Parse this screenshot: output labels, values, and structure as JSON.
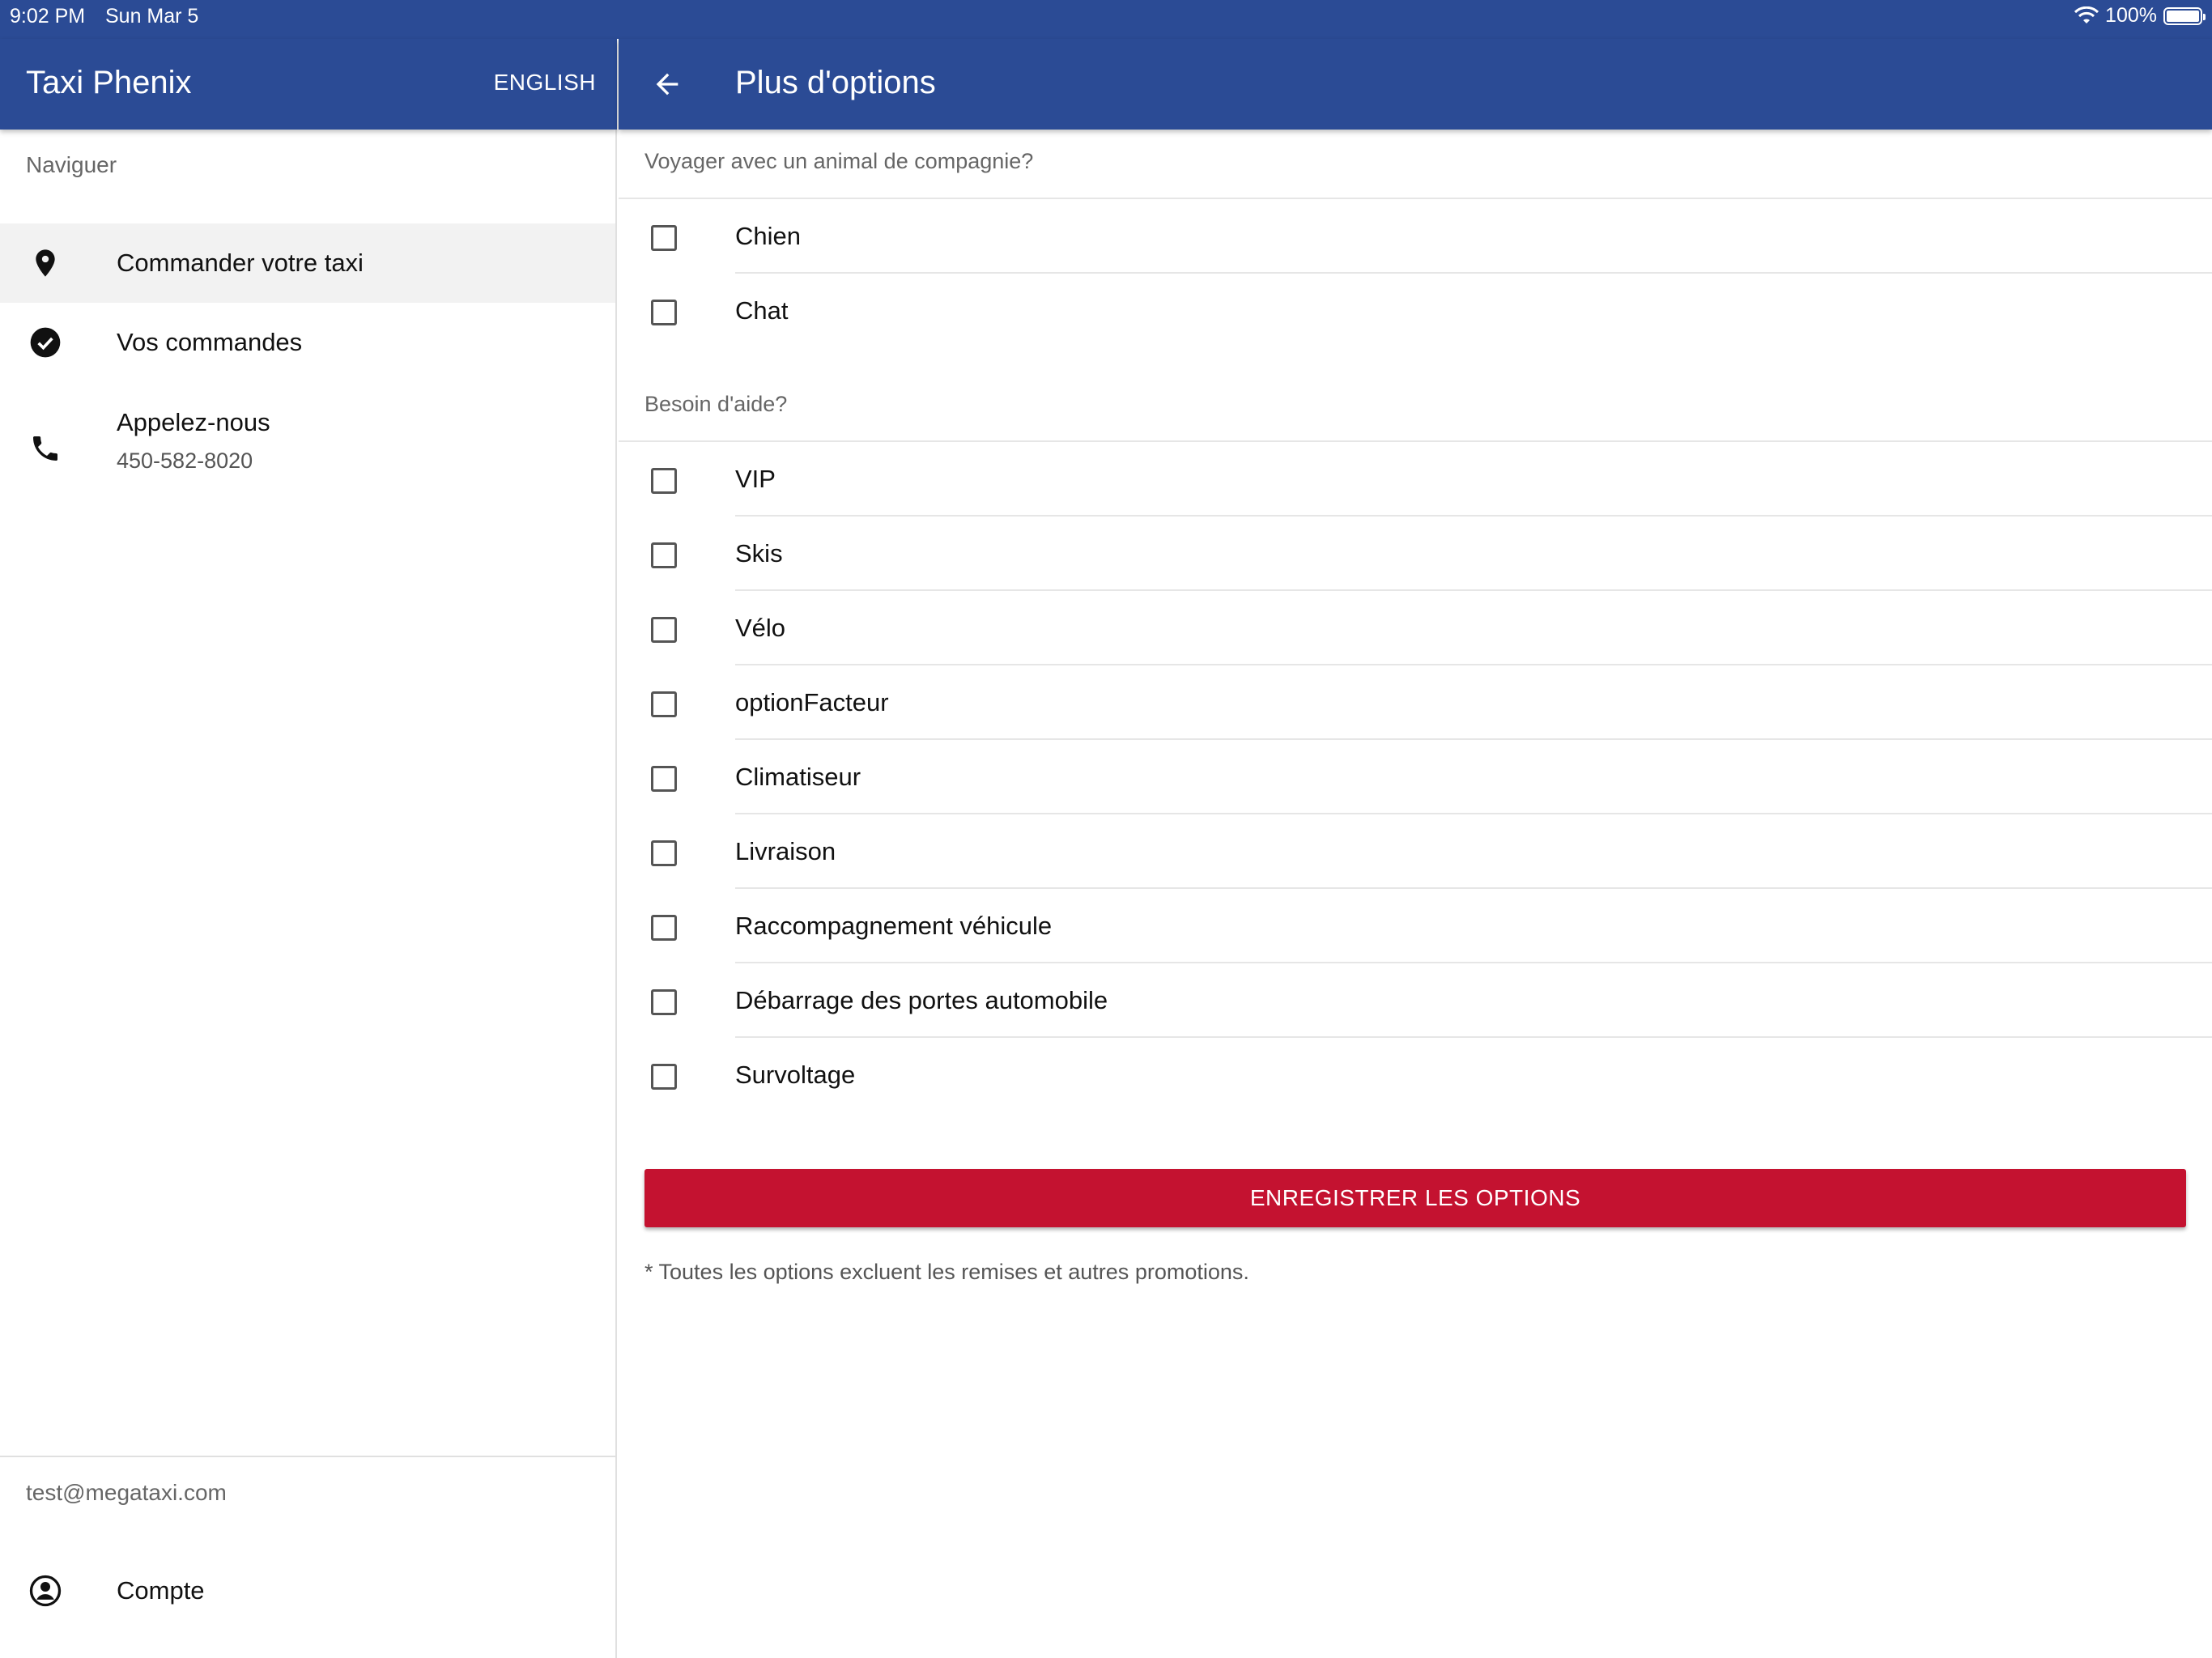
{
  "status": {
    "time": "9:02 PM",
    "date": "Sun Mar 5",
    "battery_text": "100%",
    "battery_level": 1.0
  },
  "drawer": {
    "title": "Taxi Phenix",
    "language_button": "ENGLISH",
    "section_label": "Naviguer",
    "items": [
      {
        "label": "Commander votre taxi",
        "icon": "location-pin-icon"
      },
      {
        "label": "Vos commandes",
        "icon": "check-circle-icon"
      },
      {
        "label": "Appelez-nous",
        "sublabel": "450-582-8020",
        "icon": "phone-icon"
      }
    ],
    "email": "test@megataxi.com",
    "account_label": "Compte"
  },
  "main": {
    "title": "Plus d'options",
    "pets_section": "Voyager avec un animal de compagnie?",
    "pets": [
      "Chien",
      "Chat"
    ],
    "help_section": "Besoin d'aide?",
    "options": [
      "VIP",
      "Skis",
      "Vélo",
      "optionFacteur",
      "Climatiseur",
      "Livraison",
      "Raccompagnement véhicule",
      "Débarrage des portes automobile",
      "Survoltage"
    ],
    "save_button": "ENREGISTRER LES OPTIONS",
    "footnote": "* Toutes les options excluent les remises et autres promotions."
  },
  "colors": {
    "primary": "#2b4b95",
    "accent_button": "#c41230",
    "active_item_bg": "#f2f2f2"
  }
}
